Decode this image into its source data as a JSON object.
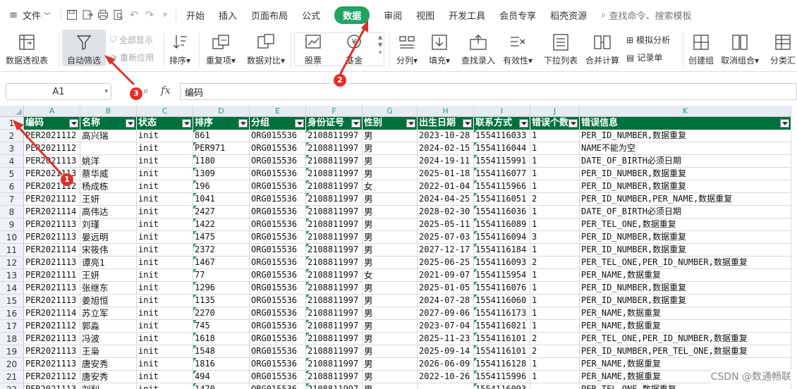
{
  "menubar": {
    "file_label": "文件",
    "tabs": [
      "开始",
      "插入",
      "页面布局",
      "公式",
      "数据",
      "审阅",
      "视图",
      "开发工具",
      "会员专享",
      "稻壳资源"
    ],
    "active_tab": "数据",
    "search_placeholder": "查找命令、搜索模板"
  },
  "ribbon": {
    "pivot": "数据透视表",
    "autofilter": "自动筛选",
    "show_all": "全部显示",
    "reapply": "重新应用",
    "sort": "排序",
    "dup": "重复项",
    "compare": "数据对比",
    "stock": "股票",
    "fund": "基金",
    "split": "分列",
    "fill": "填充",
    "lookup": "查找录入",
    "validity": "有效性",
    "dropdown": "下拉列表",
    "consolidate": "合并计算",
    "simulate": "模拟分析",
    "record": "记录单",
    "group": "创建组",
    "ungroup": "取消组合",
    "subtotal": "分类汇"
  },
  "formula_bar": {
    "name_box": "A1",
    "fx": "fx",
    "content": "编码"
  },
  "columns": [
    "A",
    "B",
    "C",
    "D",
    "E",
    "F",
    "G",
    "H",
    "I",
    "J",
    "K"
  ],
  "headers": [
    "编码",
    "名称",
    "状态",
    "排序",
    "分组",
    "身份证号",
    "性别",
    "出生日期",
    "联系方式",
    "错误个数",
    "错误信息"
  ],
  "rows": [
    [
      "PER2021112",
      "高兴瑞",
      "init",
      "861",
      "ORG015536",
      "2108811997",
      "男",
      "2023-10-28",
      "1554116033",
      "1",
      "PER_ID_NUMBER,数据重复"
    ],
    [
      "PER2021112",
      "",
      "init",
      "PER971",
      "ORG015536",
      "2108811997",
      "男",
      "2024-02-15",
      "1554116044",
      "1",
      "NAME不能为空"
    ],
    [
      "PER2021113",
      "姚洋",
      "init",
      "1180",
      "ORG015536",
      "2108811997",
      "男",
      "2024-19-11",
      "1554115991",
      "1",
      "DATE_OF_BIRTH必须日期"
    ],
    [
      "PER2021113",
      "蔡华威",
      "init",
      "1309",
      "ORG015536",
      "2108811997",
      "男",
      "2025-01-18",
      "1554116077",
      "1",
      "PER_ID_NUMBER,数据重复"
    ],
    [
      "PER2021112",
      "杨成栋",
      "init",
      "196",
      "ORG015536",
      "2108811997",
      "女",
      "2022-01-04",
      "1554115966",
      "1",
      "PER_ID_NUMBER,数据重复"
    ],
    [
      "PER2021112",
      "王妍",
      "init",
      "1041",
      "ORG015536",
      "2108811997",
      "男",
      "2024-04-25",
      "1554116051",
      "2",
      "PER_ID_NUMBER,PER_NAME,数据重复"
    ],
    [
      "PER2021114",
      "高伟达",
      "init",
      "2427",
      "ORG015536",
      "2108811997",
      "男",
      "2028-02-30",
      "1554116036",
      "1",
      "DATE_OF_BIRTH必须日期"
    ],
    [
      "PER2021113",
      "刘瑾",
      "init",
      "1422",
      "ORG015536",
      "2108811997",
      "男",
      "2025-05-11",
      "1554116089",
      "1",
      "PER_TEL_ONE,数据重复"
    ],
    [
      "PER2021113",
      "晏远明",
      "init",
      "1475",
      "ORG015536",
      "2108811997",
      "男",
      "2025-07-03",
      "1554116094",
      "3",
      "PER_ID_NUMBER,数据重复"
    ],
    [
      "PER2021114",
      "宋筱伟",
      "init",
      "2372",
      "ORG015536",
      "2108811997",
      "男",
      "2027-12-17",
      "1554116184",
      "1",
      "PER_ID_NUMBER,数据重复"
    ],
    [
      "PER2021113",
      "谭亮1",
      "init",
      "1467",
      "ORG015536",
      "2108811997",
      "男",
      "2025-06-25",
      "1554116093",
      "2",
      "PER_TEL_ONE,PER_ID_NUMBER,数据重复"
    ],
    [
      "PER2021111",
      "王妍",
      "init",
      "77",
      "ORG015536",
      "2108811997",
      "女",
      "2021-09-07",
      "1554115954",
      "1",
      "PER_NAME,数据重复"
    ],
    [
      "PER2021113",
      "张继东",
      "init",
      "1296",
      "ORG015536",
      "2108811997",
      "男",
      "2025-01-05",
      "1554116076",
      "1",
      "PER_ID_NUMBER,数据重复"
    ],
    [
      "PER2021113",
      "姜旭恒",
      "init",
      "1135",
      "ORG015536",
      "2108811997",
      "男",
      "2024-07-28",
      "1554116060",
      "1",
      "PER_ID_NUMBER,数据重复"
    ],
    [
      "PER2021114",
      "苏立军",
      "init",
      "2270",
      "ORG015536",
      "2108811997",
      "男",
      "2027-09-06",
      "1554116173",
      "1",
      "PER_NAME,数据重复"
    ],
    [
      "PER2021112",
      "郭淼",
      "init",
      "745",
      "ORG015536",
      "2108811997",
      "男",
      "2023-07-04",
      "1554116021",
      "1",
      "PER_NAME,数据重复"
    ],
    [
      "PER2021113",
      "冯波",
      "init",
      "1618",
      "ORG015536",
      "2108811997",
      "男",
      "2025-11-23",
      "1554116101",
      "2",
      "PER_TEL_ONE,PER_ID_NUMBER,数据重复"
    ],
    [
      "PER2021113",
      "王枭",
      "init",
      "1548",
      "ORG015536",
      "2108811997",
      "男",
      "2025-09-14",
      "1554116101",
      "2",
      "PER_ID_NUMBER,PER_TEL_ONE,数据重复"
    ],
    [
      "PER2021113",
      "唐安秀",
      "init",
      "1816",
      "ORG015536",
      "2108811997",
      "男",
      "2026-06-09",
      "1554116128",
      "1",
      "PER_NAME,数据重复"
    ],
    [
      "PER2021112",
      "唐安秀",
      "init",
      "494",
      "ORG015536",
      "2108811997",
      "男",
      "2022-10-26",
      "1554115996",
      "1",
      "PER_NAME,数据重复"
    ]
  ],
  "partial_row": [
    "PER2021113",
    "刘利",
    "init",
    "1470",
    "ORG015536",
    "2108811997",
    "男",
    "",
    "1554116093",
    "",
    "PER_TEL_ONE,数据重复"
  ],
  "annotations": {
    "badge1": "1",
    "badge2": "2",
    "badge3": "3"
  },
  "watermark": "CSDN @数通畅联",
  "colors": {
    "accent": "#21a366",
    "header_fill": "#00703c",
    "annotation": "#e0312b"
  }
}
